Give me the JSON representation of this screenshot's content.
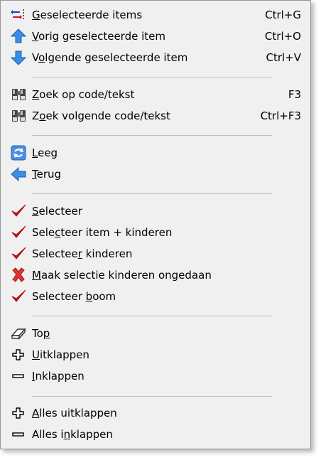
{
  "menu": {
    "items": [
      {
        "icon": "selected-items-icon",
        "pre": "",
        "u": "G",
        "post": "eselecteerde items",
        "shortcut": "Ctrl+G"
      },
      {
        "icon": "arrow-up-icon",
        "pre": "",
        "u": "V",
        "post": "orig geselecteerde item",
        "shortcut": "Ctrl+O"
      },
      {
        "icon": "arrow-down-icon",
        "pre": "V",
        "u": "o",
        "post": "lgende geselecteerde item",
        "shortcut": "Ctrl+V"
      },
      {
        "icon": "binoculars-icon",
        "pre": "",
        "u": "Z",
        "post": "oek op code/tekst",
        "shortcut": "F3"
      },
      {
        "icon": "binoculars-icon",
        "pre": "Z",
        "u": "o",
        "post": "ek volgende code/tekst",
        "shortcut": "Ctrl+F3"
      },
      {
        "icon": "refresh-icon",
        "pre": "",
        "u": "L",
        "post": "eeg",
        "shortcut": ""
      },
      {
        "icon": "arrow-left-icon",
        "pre": "",
        "u": "T",
        "post": "erug",
        "shortcut": ""
      },
      {
        "icon": "checkmark-icon",
        "pre": "",
        "u": "S",
        "post": "electeer",
        "shortcut": ""
      },
      {
        "icon": "checkmark-icon",
        "pre": "Sele",
        "u": "c",
        "post": "teer item + kinderen",
        "shortcut": ""
      },
      {
        "icon": "checkmark-icon",
        "pre": "Selectee",
        "u": "r",
        "post": " kinderen",
        "shortcut": ""
      },
      {
        "icon": "red-x-icon",
        "pre": "",
        "u": "M",
        "post": "aak selectie kinderen ongedaan",
        "shortcut": ""
      },
      {
        "icon": "checkmark-icon",
        "pre": "Selecteer ",
        "u": "b",
        "post": "oom",
        "shortcut": ""
      },
      {
        "icon": "top-eraser-icon",
        "pre": "To",
        "u": "p",
        "post": "",
        "shortcut": ""
      },
      {
        "icon": "plus-icon",
        "pre": "",
        "u": "U",
        "post": "itklappen",
        "shortcut": ""
      },
      {
        "icon": "minus-icon",
        "pre": "",
        "u": "I",
        "post": "nklappen",
        "shortcut": ""
      },
      {
        "icon": "plus-icon",
        "pre": "",
        "u": "A",
        "post": "lles uitklappen",
        "shortcut": ""
      },
      {
        "icon": "minus-icon",
        "pre": "Alles i",
        "u": "n",
        "post": "klappen",
        "shortcut": ""
      }
    ]
  },
  "colors": {
    "menu_bg": "#f0f0f0",
    "check": "#d0141a",
    "arrow_blue": "#2a7fd8"
  }
}
